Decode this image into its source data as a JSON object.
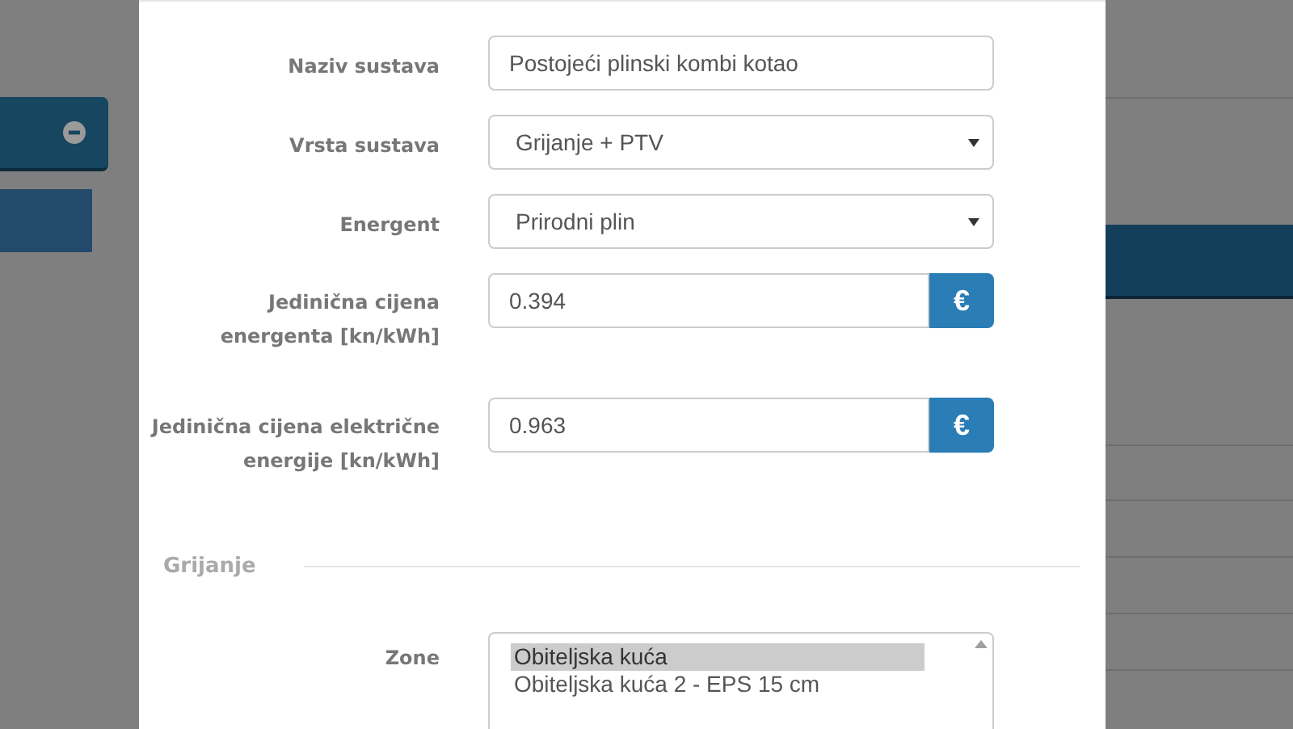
{
  "form": {
    "fields": [
      {
        "kind": "text",
        "label": "Naziv sustava",
        "value": "Postojeći plinski kombi kotao"
      },
      {
        "kind": "select",
        "label": "Vrsta sustava",
        "value": "Grijanje + PTV"
      },
      {
        "kind": "select",
        "label": "Energent",
        "value": "Prirodni plin"
      },
      {
        "kind": "addon",
        "label": "Jedinična cijena energenta [kn/kWh]",
        "value": "0.394",
        "addon": "€"
      },
      {
        "kind": "addon",
        "label": "Jedinična cijena električne energije [kn/kWh]",
        "value": "0.963",
        "addon": "€"
      }
    ]
  },
  "section": {
    "title": "Grijanje",
    "zone": {
      "label": "Zone",
      "options": [
        {
          "label": "Obiteljska kuća",
          "selected": true
        },
        {
          "label": "Obiteljska kuća 2 - EPS 15 cm",
          "selected": false
        }
      ]
    }
  }
}
